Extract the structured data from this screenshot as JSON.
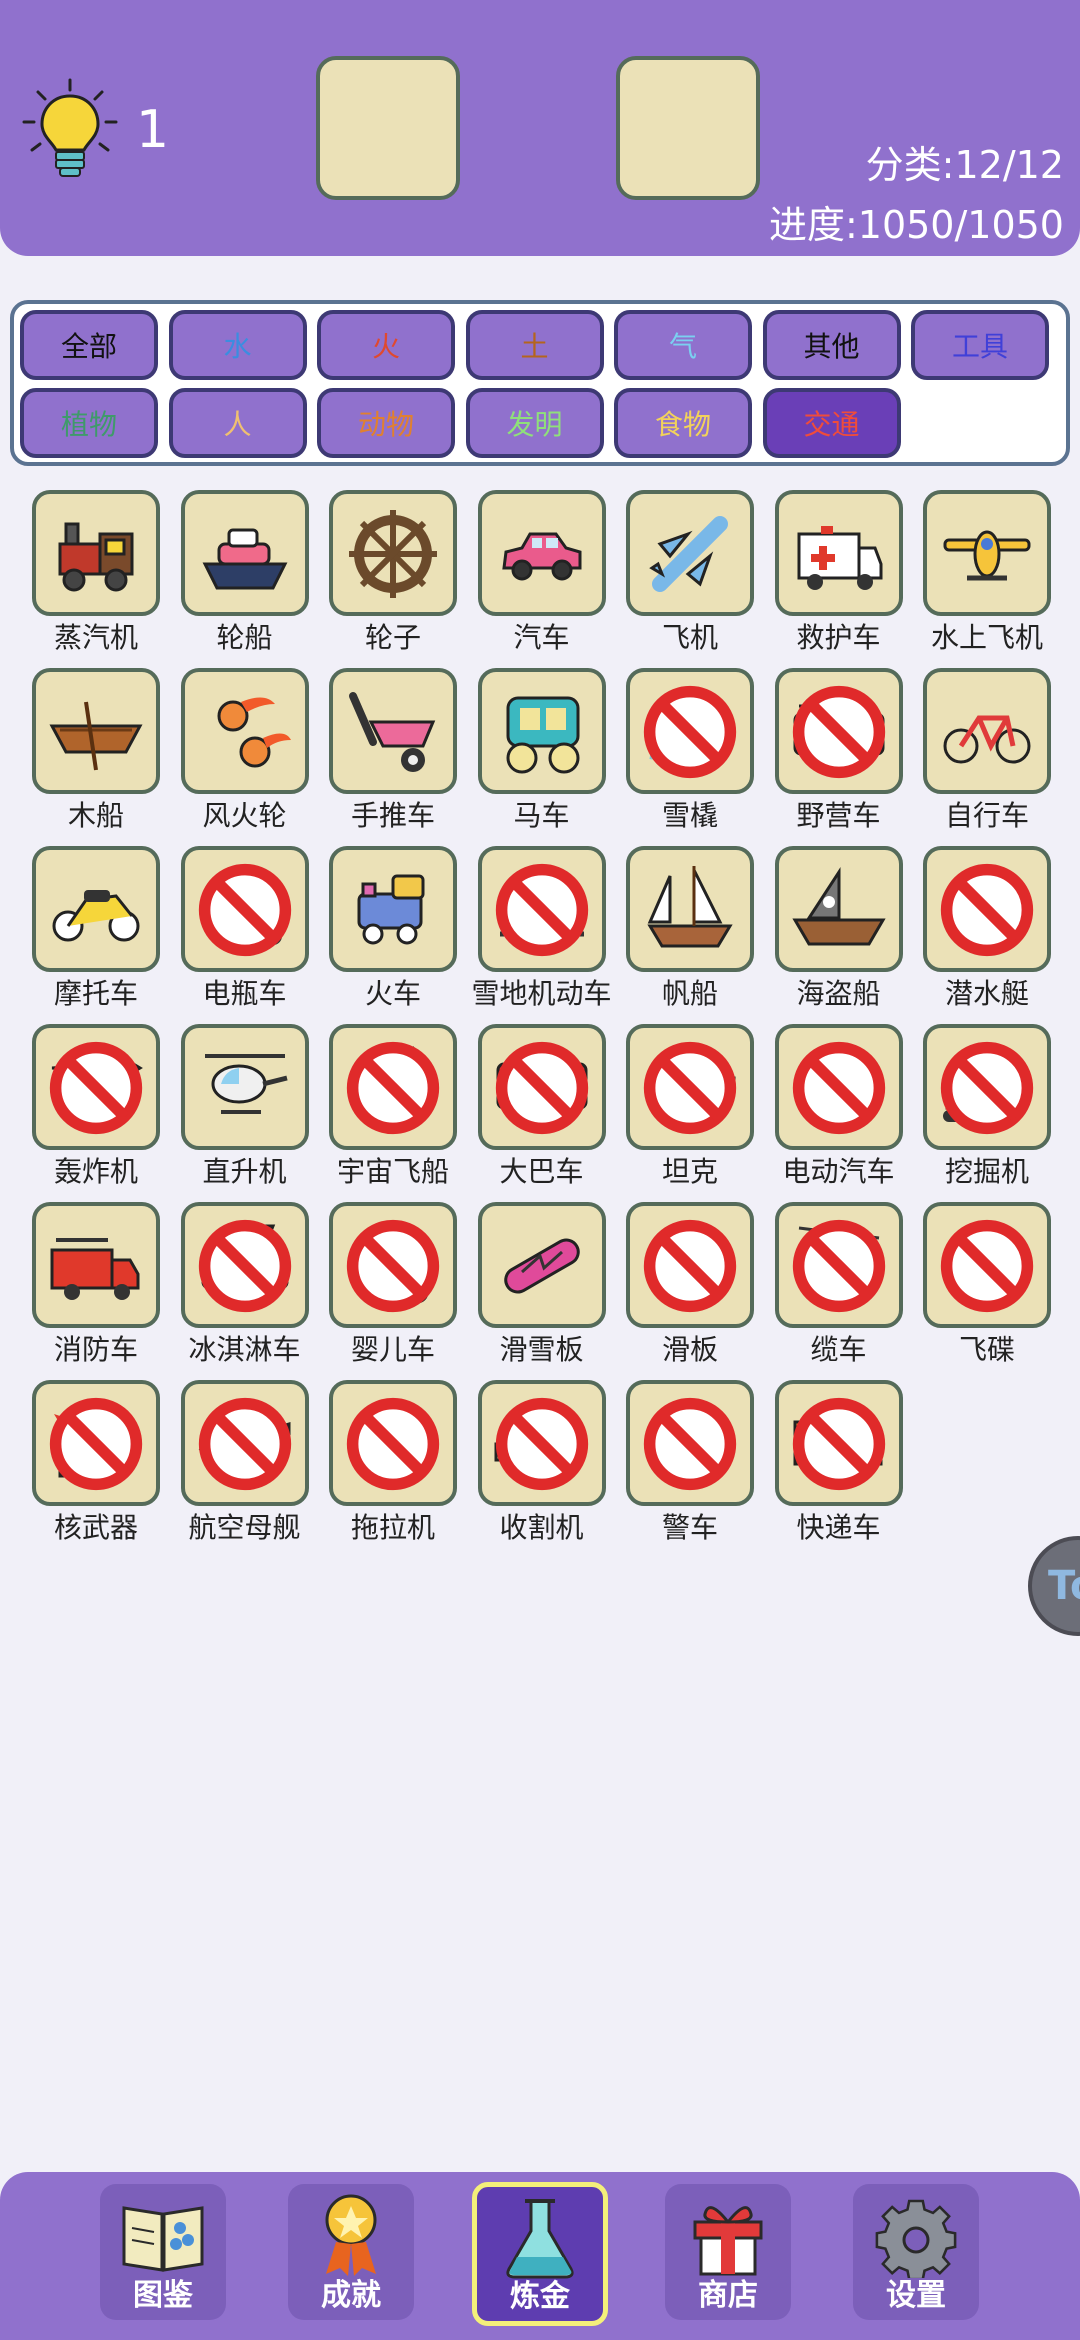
{
  "header": {
    "hint_count": "1",
    "category_label": "分类:12/12",
    "progress_label": "进度:1050/1050",
    "hint_icon": "lightbulb-icon"
  },
  "filters": [
    {
      "label": "全部",
      "color": "#111111",
      "active": false
    },
    {
      "label": "水",
      "color": "#3b8de0",
      "active": false
    },
    {
      "label": "火",
      "color": "#e0492f",
      "active": false
    },
    {
      "label": "土",
      "color": "#b5651d",
      "active": false
    },
    {
      "label": "气",
      "color": "#7ad0f0",
      "active": false
    },
    {
      "label": "其他",
      "color": "#111111",
      "active": false
    },
    {
      "label": "工具",
      "color": "#4040d8",
      "active": false
    },
    {
      "label": "植物",
      "color": "#3f9a6a",
      "active": false
    },
    {
      "label": "人",
      "color": "#f0c070",
      "active": false
    },
    {
      "label": "动物",
      "color": "#e08030",
      "active": false
    },
    {
      "label": "发明",
      "color": "#8fe07a",
      "active": false
    },
    {
      "label": "食物",
      "color": "#f2d25a",
      "active": false
    },
    {
      "label": "交通",
      "color": "#f04c3a",
      "active": true
    }
  ],
  "items": [
    {
      "label": "蒸汽机",
      "icon": "steam-engine-icon",
      "locked": false
    },
    {
      "label": "轮船",
      "icon": "ship-icon",
      "locked": false
    },
    {
      "label": "轮子",
      "icon": "wheel-icon",
      "locked": false
    },
    {
      "label": "汽车",
      "icon": "car-icon",
      "locked": false
    },
    {
      "label": "飞机",
      "icon": "airplane-icon",
      "locked": false
    },
    {
      "label": "救护车",
      "icon": "ambulance-icon",
      "locked": false
    },
    {
      "label": "水上飞机",
      "icon": "seaplane-icon",
      "locked": false
    },
    {
      "label": "木船",
      "icon": "wooden-boat-icon",
      "locked": false
    },
    {
      "label": "风火轮",
      "icon": "fire-wheels-icon",
      "locked": false
    },
    {
      "label": "手推车",
      "icon": "wheelbarrow-icon",
      "locked": false
    },
    {
      "label": "马车",
      "icon": "carriage-icon",
      "locked": false
    },
    {
      "label": "雪橇",
      "icon": "sled-icon",
      "locked": true
    },
    {
      "label": "野营车",
      "icon": "camper-icon",
      "locked": true
    },
    {
      "label": "自行车",
      "icon": "bicycle-icon",
      "locked": false
    },
    {
      "label": "摩托车",
      "icon": "motorcycle-icon",
      "locked": false
    },
    {
      "label": "电瓶车",
      "icon": "scooter-icon",
      "locked": true
    },
    {
      "label": "火车",
      "icon": "train-icon",
      "locked": false
    },
    {
      "label": "雪地机动车",
      "icon": "snowmobile-icon",
      "locked": true
    },
    {
      "label": "帆船",
      "icon": "sailing-ship-icon",
      "locked": false
    },
    {
      "label": "海盗船",
      "icon": "pirate-ship-icon",
      "locked": false
    },
    {
      "label": "潜水艇",
      "icon": "submarine-icon",
      "locked": true
    },
    {
      "label": "轰炸机",
      "icon": "bomber-icon",
      "locked": true
    },
    {
      "label": "直升机",
      "icon": "helicopter-icon",
      "locked": false
    },
    {
      "label": "宇宙飞船",
      "icon": "rocket-icon",
      "locked": true
    },
    {
      "label": "大巴车",
      "icon": "bus-icon",
      "locked": true
    },
    {
      "label": "坦克",
      "icon": "tank-icon",
      "locked": true
    },
    {
      "label": "电动汽车",
      "icon": "electric-car-icon",
      "locked": true
    },
    {
      "label": "挖掘机",
      "icon": "excavator-icon",
      "locked": true
    },
    {
      "label": "消防车",
      "icon": "fire-truck-icon",
      "locked": false
    },
    {
      "label": "冰淇淋车",
      "icon": "ice-cream-truck-icon",
      "locked": true
    },
    {
      "label": "婴儿车",
      "icon": "stroller-icon",
      "locked": true
    },
    {
      "label": "滑雪板",
      "icon": "snowboard-icon",
      "locked": false
    },
    {
      "label": "滑板",
      "icon": "skateboard-icon",
      "locked": true
    },
    {
      "label": "缆车",
      "icon": "cable-car-icon",
      "locked": true
    },
    {
      "label": "飞碟",
      "icon": "ufo-icon",
      "locked": true
    },
    {
      "label": "核武器",
      "icon": "nuclear-missile-icon",
      "locked": true
    },
    {
      "label": "航空母舰",
      "icon": "aircraft-carrier-icon",
      "locked": true
    },
    {
      "label": "拖拉机",
      "icon": "tractor-icon",
      "locked": true
    },
    {
      "label": "收割机",
      "icon": "harvester-icon",
      "locked": true
    },
    {
      "label": "警车",
      "icon": "police-car-icon",
      "locked": true
    },
    {
      "label": "快递车",
      "icon": "delivery-truck-icon",
      "locked": true
    }
  ],
  "side_button": {
    "text": "To"
  },
  "nav": [
    {
      "label": "图鉴",
      "icon": "encyclopedia-book-icon",
      "active": false
    },
    {
      "label": "成就",
      "icon": "medal-icon",
      "active": false
    },
    {
      "label": "炼金",
      "icon": "flask-icon",
      "active": true
    },
    {
      "label": "商店",
      "icon": "gift-icon",
      "active": false
    },
    {
      "label": "设置",
      "icon": "gear-icon",
      "active": false
    }
  ]
}
